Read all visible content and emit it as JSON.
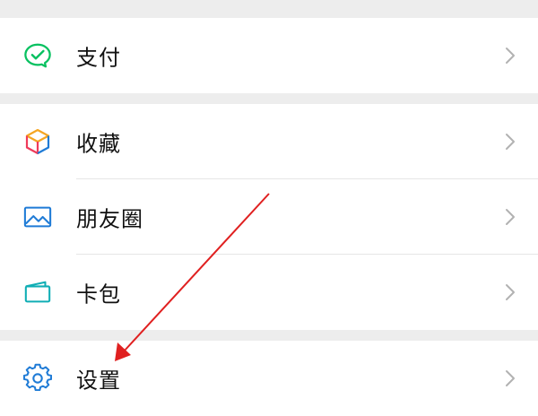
{
  "menu": {
    "pay": {
      "label": "支付",
      "icon": "wechat-pay-icon"
    },
    "favorites": {
      "label": "收藏",
      "icon": "favorites-cube-icon"
    },
    "moments": {
      "label": "朋友圈",
      "icon": "moments-image-icon"
    },
    "card_wallet": {
      "label": "卡包",
      "icon": "card-wallet-icon"
    },
    "settings": {
      "label": "设置",
      "icon": "settings-gear-icon"
    }
  },
  "colors": {
    "background": "#ededed",
    "row_background": "#ffffff",
    "text": "#111111",
    "chevron": "#b2b2b2",
    "pay_green": "#07c160",
    "blue_icon": "#1f7bd6",
    "annotation_arrow": "#e02020"
  },
  "annotation": {
    "type": "arrow",
    "points_to": "settings"
  }
}
